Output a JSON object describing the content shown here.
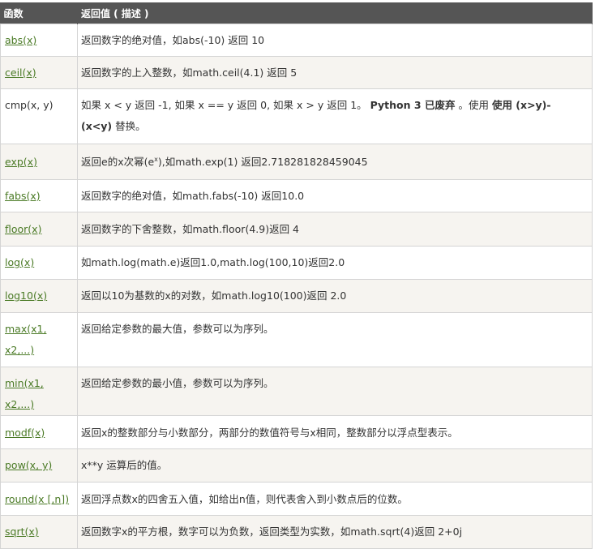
{
  "header": {
    "col_function": "函数",
    "col_return": "返回值 ( 描述 )"
  },
  "rows": [
    {
      "fn": "abs(x)",
      "desc": "返回数字的绝对值，如abs(-10) 返回 10"
    },
    {
      "fn": "ceil(x)",
      "desc": "返回数字的上入整数，如math.ceil(4.1) 返回 5"
    },
    {
      "fn": "cmp(x, y)",
      "desc_parts": [
        "如果 x < y 返回 -1, 如果 x == y 返回 0, 如果 x > y 返回 1。",
        "Python 3 已废弃",
        "。使用",
        "使用 (x>y)-(x<y)",
        "替换。"
      ]
    },
    {
      "fn": "exp(x)",
      "desc_parts": [
        "返回e的x次幂(e",
        "x",
        "),如math.exp(1) 返回2.718281828459045"
      ]
    },
    {
      "fn": "fabs(x)",
      "desc": "返回数字的绝对值，如math.fabs(-10) 返回10.0"
    },
    {
      "fn": "floor(x)",
      "desc": "返回数字的下舍整数，如math.floor(4.9)返回 4"
    },
    {
      "fn": "log(x)",
      "desc": "如math.log(math.e)返回1.0,math.log(100,10)返回2.0"
    },
    {
      "fn": "log10(x)",
      "desc": "返回以10为基数的x的对数，如math.log10(100)返回 2.0"
    },
    {
      "fn_line1": "max(x1,",
      "fn_line2": "x2,...)",
      "desc": "返回给定参数的最大值，参数可以为序列。"
    },
    {
      "fn": "min(x1, x2,...)",
      "desc": "返回给定参数的最小值，参数可以为序列。"
    },
    {
      "fn": "modf(x)",
      "desc": "返回x的整数部分与小数部分，两部分的数值符号与x相同，整数部分以浮点型表示。"
    },
    {
      "fn": "pow(x, y)",
      "desc": "x**y 运算后的值。"
    },
    {
      "fn": "round(x [,n])",
      "desc": "返回浮点数x的四舍五入值，如给出n值，则代表舍入到小数点后的位数。"
    },
    {
      "fn": "sqrt(x)",
      "desc": "返回数字x的平方根，数字可以为负数，返回类型为实数，如math.sqrt(4)返回 2+0j"
    }
  ]
}
